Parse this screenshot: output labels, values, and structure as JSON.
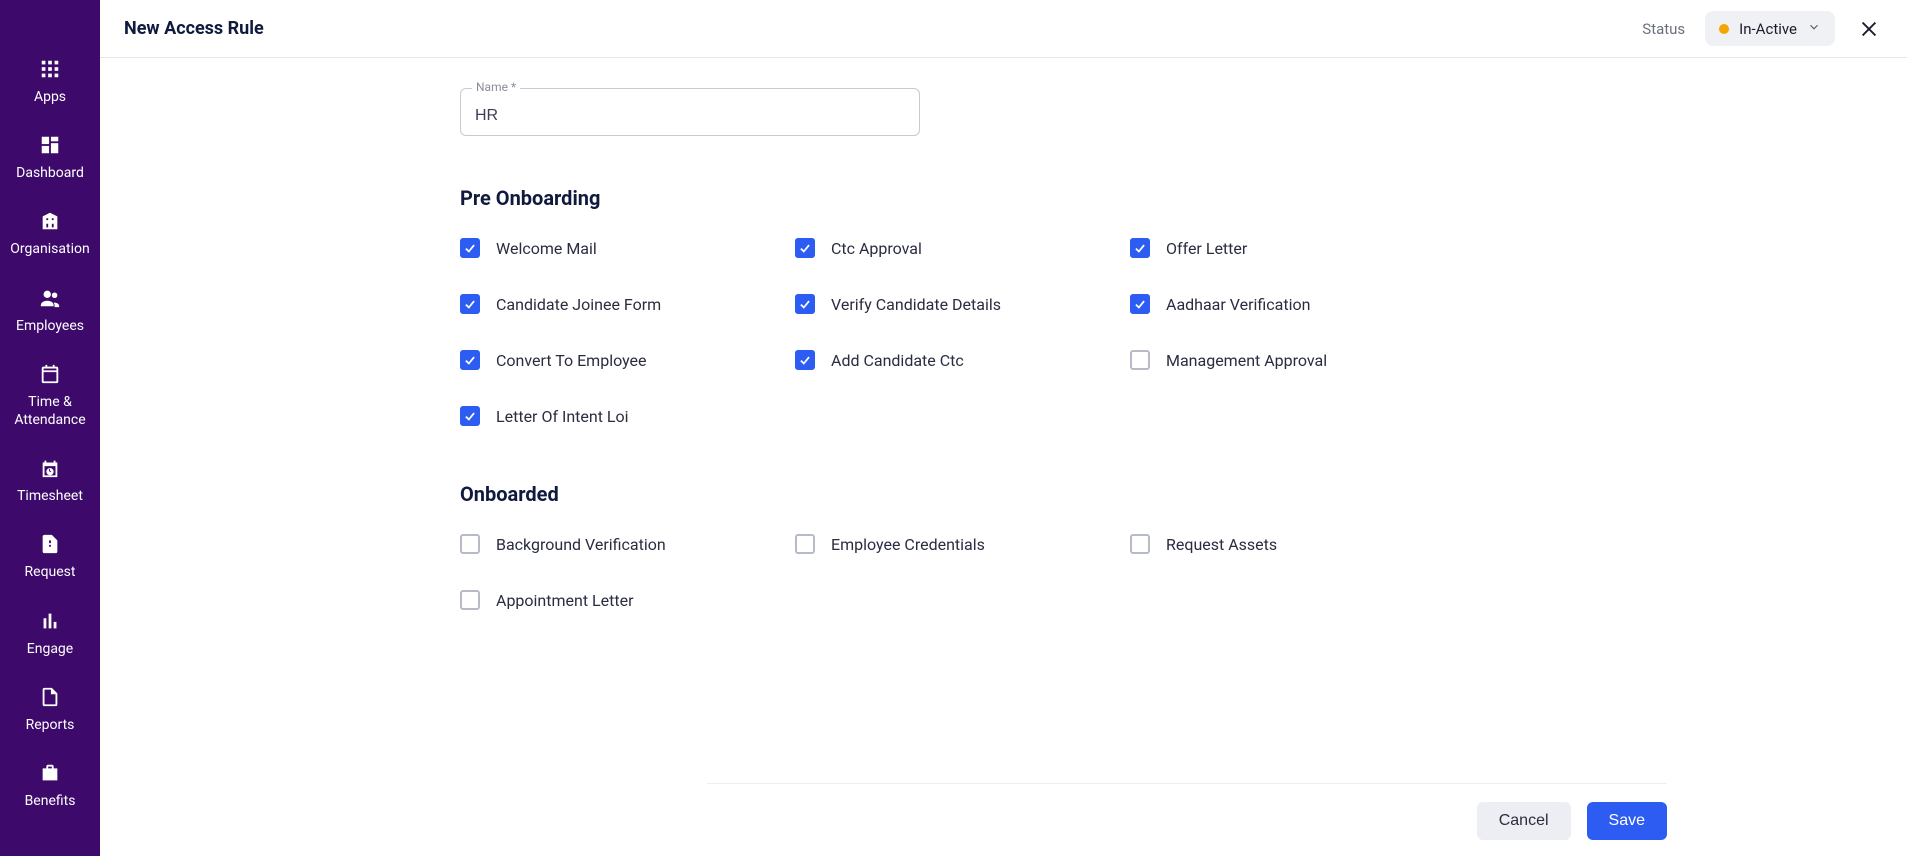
{
  "sidebar": {
    "items": [
      {
        "label": "Apps",
        "icon": "apps"
      },
      {
        "label": "Dashboard",
        "icon": "dashboard"
      },
      {
        "label": "Organisation",
        "icon": "organisation"
      },
      {
        "label": "Employees",
        "icon": "employees"
      },
      {
        "label": "Time & Attendance",
        "icon": "time"
      },
      {
        "label": "Timesheet",
        "icon": "timesheet"
      },
      {
        "label": "Request",
        "icon": "request"
      },
      {
        "label": "Engage",
        "icon": "engage"
      },
      {
        "label": "Reports",
        "icon": "reports"
      },
      {
        "label": "Benefits",
        "icon": "benefits"
      }
    ]
  },
  "header": {
    "title": "New Access Rule",
    "status_label": "Status",
    "status_value": "In-Active",
    "status_color": "#f5a500"
  },
  "form": {
    "name_label": "Name *",
    "name_value": "HR"
  },
  "sections": [
    {
      "title": "Pre Onboarding",
      "items": [
        {
          "label": "Welcome Mail",
          "checked": true
        },
        {
          "label": "Ctc Approval",
          "checked": true
        },
        {
          "label": "Offer Letter",
          "checked": true
        },
        {
          "label": "Candidate Joinee Form",
          "checked": true
        },
        {
          "label": "Verify Candidate Details",
          "checked": true
        },
        {
          "label": "Aadhaar Verification",
          "checked": true
        },
        {
          "label": "Convert To Employee",
          "checked": true
        },
        {
          "label": "Add Candidate Ctc",
          "checked": true
        },
        {
          "label": "Management Approval",
          "checked": false
        },
        {
          "label": "Letter Of Intent Loi",
          "checked": true
        }
      ]
    },
    {
      "title": "Onboarded",
      "items": [
        {
          "label": "Background Verification",
          "checked": false
        },
        {
          "label": "Employee Credentials",
          "checked": false
        },
        {
          "label": "Request Assets",
          "checked": false
        },
        {
          "label": "Appointment Letter",
          "checked": false
        }
      ]
    }
  ],
  "footer": {
    "cancel": "Cancel",
    "save": "Save"
  }
}
